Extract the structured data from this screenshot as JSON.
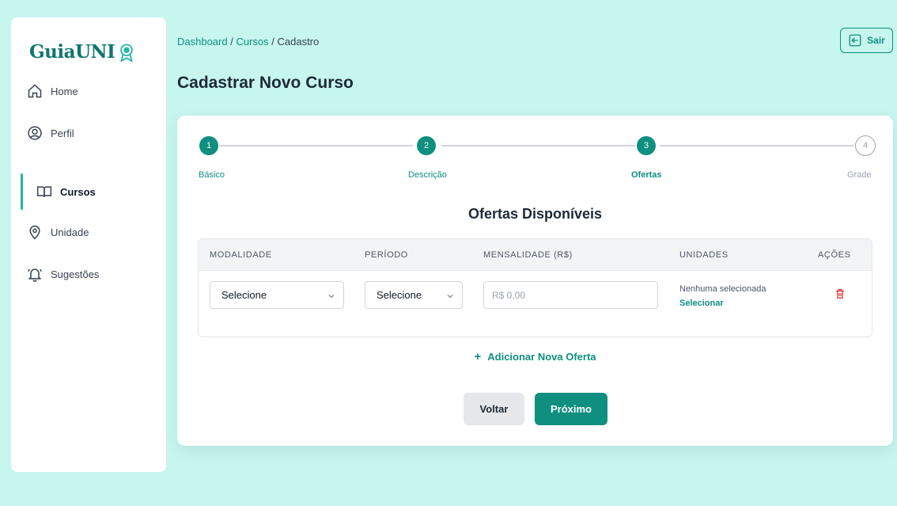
{
  "app": {
    "logo_text": "GuiaUNI",
    "accent": "#0e8f80"
  },
  "sidebar": {
    "items": [
      {
        "label": "Home",
        "icon": "home-icon"
      },
      {
        "label": "Perfil",
        "icon": "user-circle-icon"
      },
      {
        "label": "Cursos",
        "icon": "book-open-icon",
        "active": true
      },
      {
        "label": "Unidade",
        "icon": "map-pin-icon"
      },
      {
        "label": "Sugestões",
        "icon": "bell-icon"
      }
    ]
  },
  "breadcrumb": {
    "dashboard": "Dashboard",
    "sep1": " / ",
    "cursos": "Cursos",
    "sep2": " / ",
    "current": "Cadastro"
  },
  "header": {
    "title": "Cadastrar Novo Curso",
    "logout_label": "Sair"
  },
  "stepper": {
    "steps": [
      {
        "num": "1",
        "label": "Básico",
        "state": "done"
      },
      {
        "num": "2",
        "label": "Descrição",
        "state": "done"
      },
      {
        "num": "3",
        "label": "Ofertas",
        "state": "current"
      },
      {
        "num": "4",
        "label": "Grade",
        "state": "pending"
      }
    ]
  },
  "offers": {
    "title": "Ofertas Disponíveis",
    "columns": [
      "MODALIDADE",
      "PERÍODO",
      "MENSALIDADE (R$)",
      "UNIDADES",
      "AÇÕES"
    ],
    "row": {
      "modalidade": "Selecione",
      "periodo": "Selecione",
      "mensalidade_placeholder": "R$ 0,00",
      "units_text": "Nenhuma selecionada",
      "units_link": "Selecionar"
    },
    "add_label": "Adicionar Nova Oferta"
  },
  "actions": {
    "back_label": "Voltar",
    "next_label": "Próximo"
  }
}
